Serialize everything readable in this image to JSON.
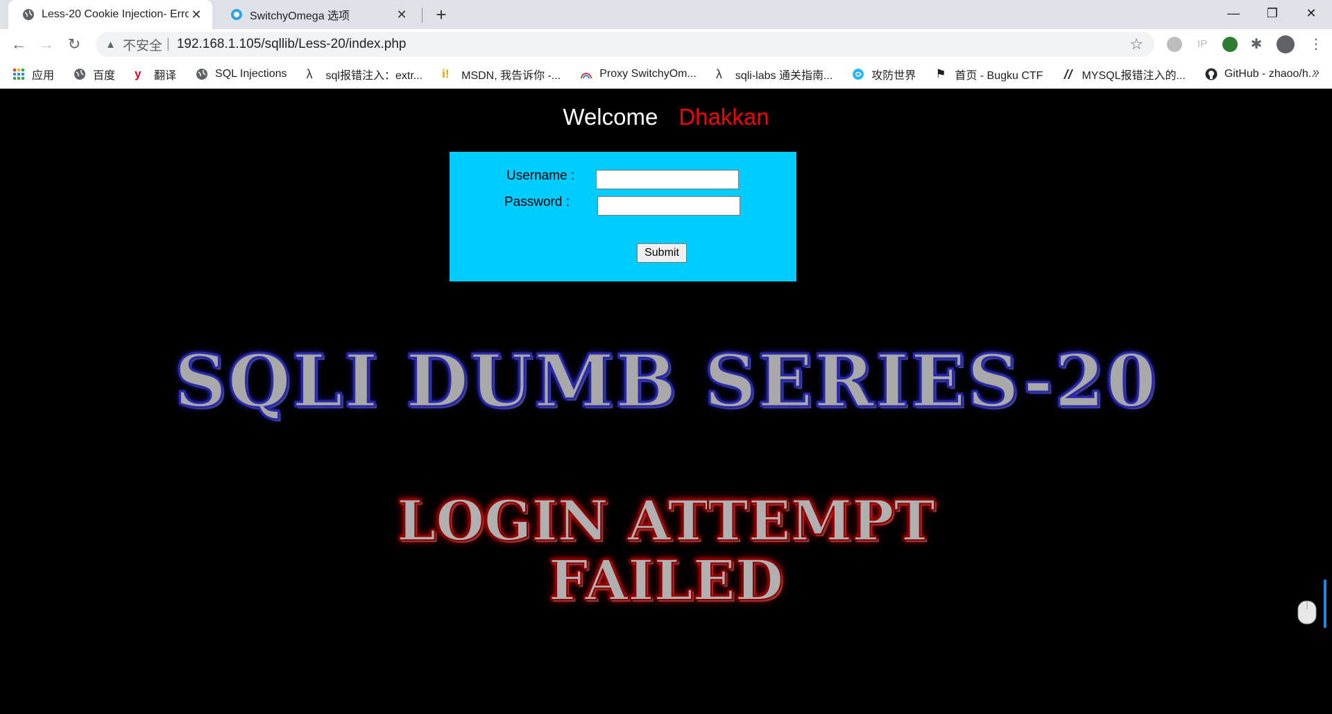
{
  "browser": {
    "tabs": [
      {
        "title": "Less-20 Cookie Injection- Erro",
        "active": true
      },
      {
        "title": "SwitchyOmega 选项",
        "active": false
      }
    ],
    "new_tab": "+",
    "window_controls": {
      "minimize": "—",
      "restore": "❐",
      "close": "✕"
    },
    "nav": {
      "back": "←",
      "forward": "→",
      "reload": "↻"
    },
    "omnibox": {
      "warning_icon": "warning-triangle-icon",
      "insecure_label": "不安全",
      "divider": "|",
      "url": "192.168.1.105/sqllib/Less-20/index.php"
    },
    "bookmarks": [
      {
        "label": "应用",
        "icon": "apps-grid-icon"
      },
      {
        "label": "百度",
        "icon": "globe-icon"
      },
      {
        "label": "翻译",
        "icon": "youdao-icon"
      },
      {
        "label": "SQL Injections",
        "icon": "globe-icon"
      },
      {
        "label": "sql报错注入：extr...",
        "icon": "lambda-icon"
      },
      {
        "label": "MSDN, 我告诉你 -...",
        "icon": "msdn-icon"
      },
      {
        "label": "Proxy SwitchyOm...",
        "icon": "rainbow-icon"
      },
      {
        "label": "sqli-labs 通关指南...",
        "icon": "lambda-icon"
      },
      {
        "label": "攻防世界",
        "icon": "swirl-icon"
      },
      {
        "label": "首页 - Bugku CTF",
        "icon": "flag-icon"
      },
      {
        "label": "MYSQL报错注入的...",
        "icon": "slash-icon"
      },
      {
        "label": "GitHub - zhaoo/h...",
        "icon": "github-icon"
      }
    ],
    "bookmarks_more": "»"
  },
  "page": {
    "welcome": "Welcome",
    "name": "Dhakkan",
    "form": {
      "username_label": "Username :",
      "password_label": "Password :",
      "username_value": "",
      "password_value": "",
      "submit_label": "Submit"
    },
    "series_title": "SQLI DUMB SERIES-20",
    "failed_line1": "LOGIN ATTEMPT",
    "failed_line2": "FAILED"
  },
  "colors": {
    "login_box_bg": "#00ccff",
    "welcome_name": "#ff0000",
    "page_bg": "#000000",
    "tabstrip_bg": "#dee1e6"
  }
}
